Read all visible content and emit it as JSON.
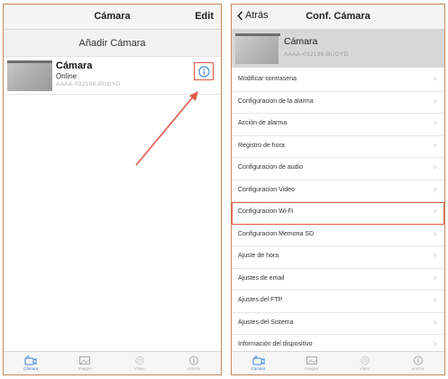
{
  "left": {
    "nav_title": "Cámara",
    "edit_label": "Edit",
    "add_camera_label": "Añadir Cámara",
    "camera": {
      "name": "Cámara",
      "status": "Online",
      "uid": "AAAA-032196-BUGYD"
    }
  },
  "right": {
    "back_label": "Atrás",
    "nav_title": "Conf. Cámara",
    "camera": {
      "name": "Cámara",
      "uid": "AAAA-032196-BUGYD"
    },
    "menu": [
      {
        "label": "Modificar contrasena"
      },
      {
        "label": "Configuracion de la alarma"
      },
      {
        "label": "Acción de alarma"
      },
      {
        "label": "Registro de hora"
      },
      {
        "label": "Configuracion de audio"
      },
      {
        "label": "Configuracion Video"
      },
      {
        "label": "Configuracion Wi-Fi",
        "highlighted": true
      },
      {
        "label": "Configuracion Memoria SD"
      },
      {
        "label": "Ajuste de hora"
      },
      {
        "label": "Ajustes de email"
      },
      {
        "label": "Ajustes del FTP"
      },
      {
        "label": "Ajustes del Sistema"
      },
      {
        "label": "Información del dispositivo"
      }
    ],
    "chevron": ">"
  },
  "tabbar": {
    "tabs": [
      {
        "label": "Cámara",
        "icon": "camera-icon",
        "active": true
      },
      {
        "label": "Imagen",
        "icon": "image-icon",
        "active": false
      },
      {
        "label": "Vídeo",
        "icon": "video-icon",
        "active": false
      },
      {
        "label": "Acerca",
        "icon": "info-icon",
        "active": false
      }
    ]
  },
  "colors": {
    "highlight": "#e05a4a",
    "active_tab": "#3a86d8",
    "frame": "#c98a5a"
  }
}
